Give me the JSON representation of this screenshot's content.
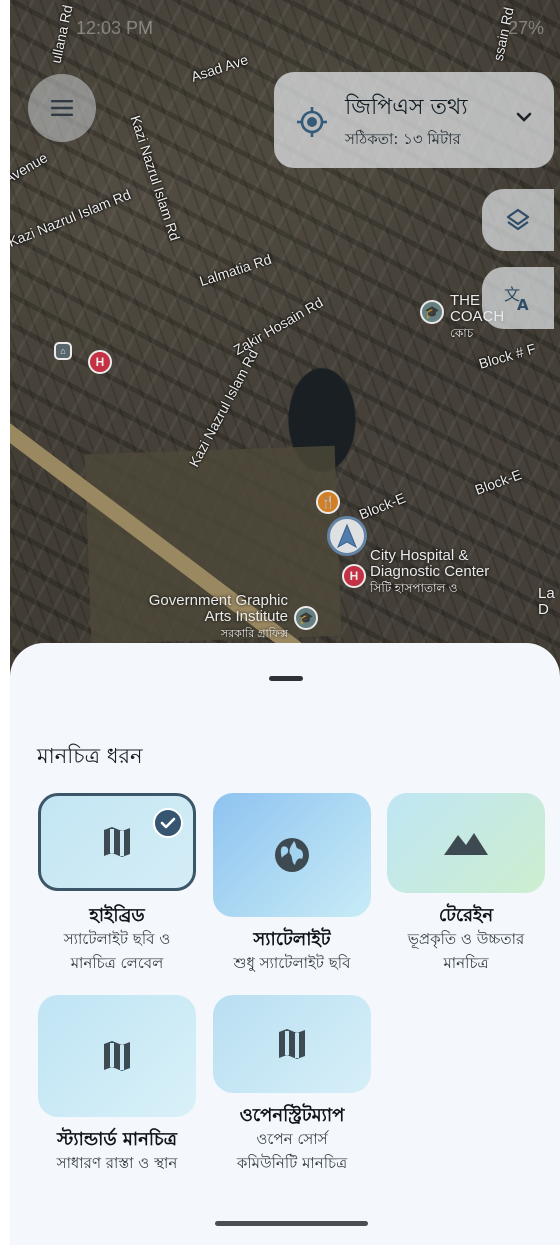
{
  "status_bar": {
    "time": "12:03 PM",
    "right": "27%"
  },
  "map": {
    "roads": [
      "Asad Ave",
      "Kazi Nazrul Islam Rd",
      "Kazi Nazrul Islam Rd",
      "Lalmatia Rd",
      "Zakir Hosain Rd",
      "Kazi Nazrul Islam Rd",
      "Block # F",
      "Block-E",
      "Block-E",
      "Avenue",
      "ssain Rd",
      "ullana Rd"
    ],
    "pois": {
      "hospital": "City Hospital & Diagnostic Center",
      "hospital_bn": "সিটি হাসপাতাল ও",
      "school": "Government Graphic Arts Institute",
      "school_bn": "সরকারি গ্রাফিক্স",
      "coach": "THE COACH",
      "coach_bn": "কোচ",
      "la_d": "La D"
    }
  },
  "gps_card": {
    "title": "জিপিএস তথ্য",
    "subtitle": "সঠিকতা: ১৩ মিটার"
  },
  "sheet": {
    "title": "মানচিত্র ধরন",
    "map_types": [
      {
        "name": "হাইব্রিড",
        "desc1": "স্যাটেলাইট ছবি ও",
        "desc2": "মানচিত্র লেবেল",
        "selected": true
      },
      {
        "name": "স্যাটেলাইট",
        "desc1": "শুধু স্যাটেলাইট ছবি",
        "desc2": ""
      },
      {
        "name": "টেরেইন",
        "desc1": "ভূপ্রকৃতি ও উচ্চতার",
        "desc2": "মানচিত্র"
      },
      {
        "name": "স্ট্যান্ডার্ড মানচিত্র",
        "desc1": "সাধারণ রাস্তা ও স্থান",
        "desc2": ""
      },
      {
        "name": "ওপেনস্ট্রিটম্যাপ",
        "desc1": "ওপেন সোর্স",
        "desc2": "কমিউনিটি মানচিত্র"
      }
    ]
  },
  "colors": {
    "accent": "#355570",
    "sheet_bg": "#f4f7fb",
    "icon": "#3e4a52"
  }
}
